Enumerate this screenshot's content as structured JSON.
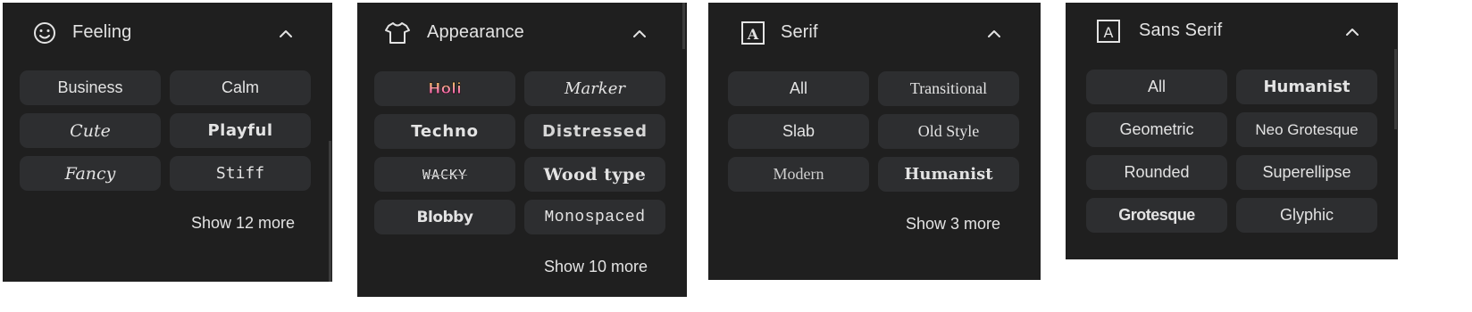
{
  "panels": [
    {
      "title": "Feeling",
      "icon": "smiley-icon",
      "chips": [
        "Business",
        "Calm",
        "Cute",
        "Playful",
        "Fancy",
        "Stiff"
      ],
      "more": "Show 12 more"
    },
    {
      "title": "Appearance",
      "icon": "tshirt-icon",
      "chips": [
        "Holi",
        "Marker",
        "Techno",
        "Distressed",
        "WACKY",
        "Wood type",
        "Blobby",
        "Monospaced"
      ],
      "more": "Show 10 more"
    },
    {
      "title": "Serif",
      "icon": "letter-a-box-icon",
      "chips": [
        "All",
        "Transitional",
        "Slab",
        "Old Style",
        "Modern",
        "Humanist"
      ],
      "more": "Show 3 more"
    },
    {
      "title": "Sans Serif",
      "icon": "letter-a-box-icon",
      "chips": [
        "All",
        "Humanist",
        "Geometric",
        "Neo Grotesque",
        "Rounded",
        "Superellipse",
        "Grotesque",
        "Glyphic"
      ]
    }
  ],
  "colors": {
    "panel_bg": "#1f1f1f",
    "chip_bg": "#2d2e30",
    "text": "#e3e3e3"
  }
}
